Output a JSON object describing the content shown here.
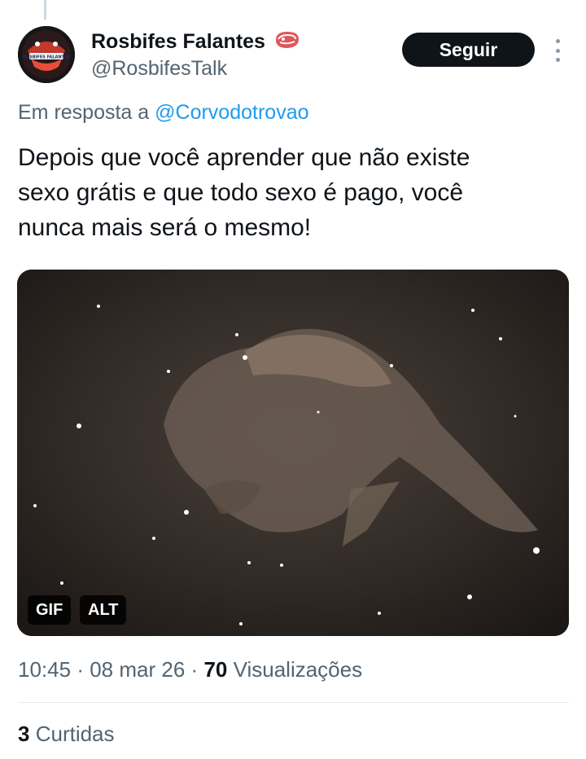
{
  "author": {
    "display_name": "Rosbifes Falantes",
    "handle": "@RosbifesTalk",
    "name_emoji_icon": "meat-steak-icon",
    "avatar_text": "ROSBIFES FALANTES"
  },
  "actions": {
    "follow_label": "Seguir",
    "more_icon": "more-options-icon"
  },
  "reply": {
    "prefix": "Em resposta a",
    "mention": "@Corvodotrovao"
  },
  "tweet": {
    "text": "Depois que você aprender que não existe\nsexo grátis e que todo sexo é pago, você\nnunca mais será o mesmo!"
  },
  "media": {
    "type_badge": "GIF",
    "alt_badge": "ALT"
  },
  "meta": {
    "time": "10:45",
    "separator": "·",
    "date": "08 mar 26",
    "views_count": "70",
    "views_label": "Visualizações"
  },
  "stats": {
    "likes_count": "3",
    "likes_label": "Curtidas"
  },
  "colors": {
    "accent": "#1d9bf0",
    "text_primary": "#0f1419",
    "text_secondary": "#536471",
    "follow_bg": "#0f1419"
  }
}
